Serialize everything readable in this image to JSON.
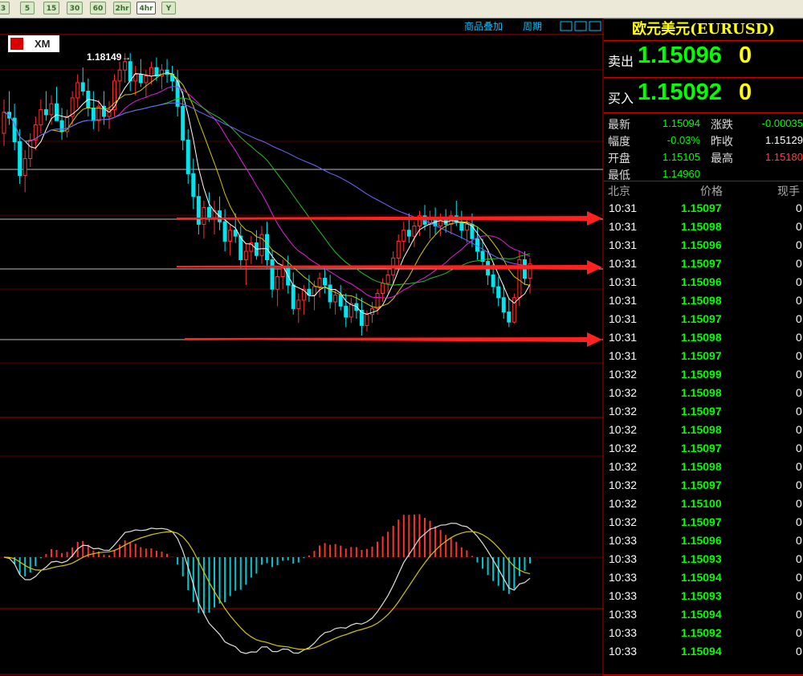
{
  "toolbar": {
    "timeframes": [
      {
        "label": "3",
        "active": false
      },
      {
        "label": "5",
        "active": false
      },
      {
        "label": "15",
        "active": false
      },
      {
        "label": "30",
        "active": false
      },
      {
        "label": "60",
        "active": false
      },
      {
        "label": "2hr",
        "active": false
      },
      {
        "label": "4hr",
        "active": true
      },
      {
        "label": "Y",
        "active": false
      }
    ]
  },
  "chart": {
    "logo": "XM",
    "menu_overlay": "商品叠加",
    "menu_period": "周期",
    "high_marker": "1.18149→",
    "candles": [
      [
        1.172,
        1.176,
        1.1705,
        1.1745
      ],
      [
        1.1745,
        1.177,
        1.173,
        1.1738
      ],
      [
        1.1738,
        1.1755,
        1.17,
        1.171
      ],
      [
        1.171,
        1.1725,
        1.166,
        1.167
      ],
      [
        1.167,
        1.17,
        1.165,
        1.169
      ],
      [
        1.169,
        1.172,
        1.168,
        1.1712
      ],
      [
        1.1712,
        1.174,
        1.17,
        1.173
      ],
      [
        1.173,
        1.176,
        1.172,
        1.1748
      ],
      [
        1.1748,
        1.177,
        1.1735,
        1.1742
      ],
      [
        1.1742,
        1.1765,
        1.173,
        1.1755
      ],
      [
        1.1755,
        1.1775,
        1.174,
        1.1735
      ],
      [
        1.1735,
        1.175,
        1.1712,
        1.1722
      ],
      [
        1.1722,
        1.1748,
        1.1715,
        1.174
      ],
      [
        1.174,
        1.177,
        1.173,
        1.1762
      ],
      [
        1.1762,
        1.179,
        1.175,
        1.178
      ],
      [
        1.178,
        1.1798,
        1.1765,
        1.177
      ],
      [
        1.177,
        1.1785,
        1.174,
        1.175
      ],
      [
        1.175,
        1.177,
        1.1725,
        1.1735
      ],
      [
        1.1735,
        1.176,
        1.1722,
        1.1752
      ],
      [
        1.1752,
        1.177,
        1.173,
        1.174
      ],
      [
        1.174,
        1.1758,
        1.1725,
        1.1748
      ],
      [
        1.1748,
        1.179,
        1.174,
        1.1782
      ],
      [
        1.1782,
        1.1805,
        1.1765,
        1.1795
      ],
      [
        1.1795,
        1.1815,
        1.178,
        1.1805
      ],
      [
        1.1805,
        1.1815,
        1.177,
        1.1782
      ],
      [
        1.1782,
        1.18,
        1.1765,
        1.179
      ],
      [
        1.179,
        1.1808,
        1.1775,
        1.178
      ],
      [
        1.178,
        1.1795,
        1.1762,
        1.1788
      ],
      [
        1.1788,
        1.1805,
        1.1778,
        1.1798
      ],
      [
        1.1798,
        1.181,
        1.1782,
        1.1788
      ],
      [
        1.1788,
        1.1802,
        1.1772,
        1.1795
      ],
      [
        1.1795,
        1.1808,
        1.178,
        1.179
      ],
      [
        1.179,
        1.18,
        1.177,
        1.1782
      ],
      [
        1.1782,
        1.1795,
        1.174,
        1.1752
      ],
      [
        1.1752,
        1.177,
        1.17,
        1.1712
      ],
      [
        1.1712,
        1.1725,
        1.166,
        1.1672
      ],
      [
        1.1672,
        1.169,
        1.163,
        1.1645
      ],
      [
        1.1645,
        1.166,
        1.16,
        1.1612
      ],
      [
        1.1612,
        1.164,
        1.1595,
        1.1632
      ],
      [
        1.1632,
        1.165,
        1.1615,
        1.162
      ],
      [
        1.162,
        1.164,
        1.16,
        1.1628
      ],
      [
        1.1628,
        1.1645,
        1.1605,
        1.1615
      ],
      [
        1.1615,
        1.163,
        1.158,
        1.1592
      ],
      [
        1.1592,
        1.1612,
        1.1575,
        1.1605
      ],
      [
        1.1605,
        1.1625,
        1.159,
        1.1598
      ],
      [
        1.1598,
        1.161,
        1.156,
        1.157
      ],
      [
        1.157,
        1.159,
        1.154,
        1.158
      ],
      [
        1.158,
        1.1598,
        1.1565,
        1.159
      ],
      [
        1.159,
        1.1605,
        1.157,
        1.1575
      ],
      [
        1.1575,
        1.161,
        1.1565,
        1.16
      ],
      [
        1.16,
        1.1615,
        1.156,
        1.157
      ],
      [
        1.157,
        1.1582,
        1.1525,
        1.1535
      ],
      [
        1.1535,
        1.156,
        1.1515,
        1.155
      ],
      [
        1.155,
        1.157,
        1.1535,
        1.156
      ],
      [
        1.156,
        1.1575,
        1.153,
        1.154
      ],
      [
        1.154,
        1.1555,
        1.1505,
        1.1512
      ],
      [
        1.1512,
        1.153,
        1.1495,
        1.1522
      ],
      [
        1.1522,
        1.154,
        1.1505,
        1.1535
      ],
      [
        1.1535,
        1.1552,
        1.152,
        1.1528
      ],
      [
        1.1528,
        1.1545,
        1.151,
        1.1538
      ],
      [
        1.1538,
        1.1555,
        1.1525,
        1.1548
      ],
      [
        1.1548,
        1.156,
        1.153,
        1.154
      ],
      [
        1.154,
        1.1552,
        1.1512,
        1.152
      ],
      [
        1.152,
        1.1535,
        1.1505,
        1.1528
      ],
      [
        1.1528,
        1.154,
        1.151,
        1.1515
      ],
      [
        1.1515,
        1.153,
        1.149,
        1.1502
      ],
      [
        1.1502,
        1.1525,
        1.1495,
        1.1518
      ],
      [
        1.1518,
        1.153,
        1.15,
        1.151
      ],
      [
        1.151,
        1.1525,
        1.148,
        1.1492
      ],
      [
        1.1492,
        1.151,
        1.1485,
        1.1505
      ],
      [
        1.1505,
        1.152,
        1.1495,
        1.1512
      ],
      [
        1.1512,
        1.1535,
        1.1505,
        1.153
      ],
      [
        1.153,
        1.1548,
        1.152,
        1.1542
      ],
      [
        1.1542,
        1.156,
        1.153,
        1.1552
      ],
      [
        1.1552,
        1.158,
        1.154,
        1.1572
      ],
      [
        1.1572,
        1.16,
        1.156,
        1.1592
      ],
      [
        1.1592,
        1.1615,
        1.158,
        1.1605
      ],
      [
        1.1605,
        1.1625,
        1.159,
        1.1598
      ],
      [
        1.1598,
        1.1615,
        1.1585,
        1.161
      ],
      [
        1.161,
        1.1628,
        1.1598,
        1.1622
      ],
      [
        1.1622,
        1.1635,
        1.1605,
        1.1612
      ],
      [
        1.1612,
        1.1628,
        1.1595,
        1.162
      ],
      [
        1.162,
        1.1632,
        1.16,
        1.161
      ],
      [
        1.161,
        1.1625,
        1.1598,
        1.1618
      ],
      [
        1.1618,
        1.163,
        1.1602,
        1.1612
      ],
      [
        1.1612,
        1.1628,
        1.16,
        1.1622
      ],
      [
        1.1622,
        1.164,
        1.161,
        1.1615
      ],
      [
        1.1615,
        1.1628,
        1.1595,
        1.1605
      ],
      [
        1.1605,
        1.162,
        1.159,
        1.1612
      ],
      [
        1.1612,
        1.1625,
        1.1585,
        1.1595
      ],
      [
        1.1595,
        1.1608,
        1.157,
        1.158
      ],
      [
        1.158,
        1.1595,
        1.156,
        1.1568
      ],
      [
        1.1568,
        1.158,
        1.154,
        1.1552
      ],
      [
        1.1552,
        1.1565,
        1.153,
        1.1538
      ],
      [
        1.1538,
        1.155,
        1.1515,
        1.1525
      ],
      [
        1.1525,
        1.154,
        1.15,
        1.1508
      ],
      [
        1.1508,
        1.1525,
        1.149,
        1.1496
      ],
      [
        1.1496,
        1.153,
        1.1494,
        1.1525
      ],
      [
        1.1525,
        1.158,
        1.1515,
        1.157
      ],
      [
        1.157,
        1.158,
        1.154,
        1.1548
      ],
      [
        1.1548,
        1.1572,
        1.153,
        1.1565
      ]
    ]
  },
  "panel": {
    "symbol": "欧元美元(EURUSD)",
    "sell_label": "卖出",
    "sell_value": "1.15096",
    "sell_digit": "0",
    "buy_label": "买入",
    "buy_value": "1.15092",
    "buy_digit": "0",
    "stats": [
      {
        "label": "最新",
        "value": "1.15094",
        "color": "#00ff00"
      },
      {
        "label": "涨跌",
        "value": "-0.00035",
        "color": "#00ff00"
      },
      {
        "label": "幅度",
        "value": "-0.03%",
        "color": "#00ff00"
      },
      {
        "label": "昨收",
        "value": "1.15129",
        "color": "#ffffff"
      },
      {
        "label": "开盘",
        "value": "1.15105",
        "color": "#00ff00"
      },
      {
        "label": "最高",
        "value": "1.15180",
        "color": "#ff4040"
      },
      {
        "label": "最低",
        "value": "1.14960",
        "color": "#00ff00"
      }
    ],
    "headers": {
      "time": "北京",
      "price": "价格",
      "volume": "现手"
    },
    "ticks": [
      {
        "time": "10:31",
        "price": "1.15097",
        "vol": "0"
      },
      {
        "time": "10:31",
        "price": "1.15098",
        "vol": "0"
      },
      {
        "time": "10:31",
        "price": "1.15096",
        "vol": "0"
      },
      {
        "time": "10:31",
        "price": "1.15097",
        "vol": "0"
      },
      {
        "time": "10:31",
        "price": "1.15096",
        "vol": "0"
      },
      {
        "time": "10:31",
        "price": "1.15098",
        "vol": "0"
      },
      {
        "time": "10:31",
        "price": "1.15097",
        "vol": "0"
      },
      {
        "time": "10:31",
        "price": "1.15098",
        "vol": "0"
      },
      {
        "time": "10:31",
        "price": "1.15097",
        "vol": "0"
      },
      {
        "time": "10:32",
        "price": "1.15099",
        "vol": "0"
      },
      {
        "time": "10:32",
        "price": "1.15098",
        "vol": "0"
      },
      {
        "time": "10:32",
        "price": "1.15097",
        "vol": "0"
      },
      {
        "time": "10:32",
        "price": "1.15098",
        "vol": "0"
      },
      {
        "time": "10:32",
        "price": "1.15097",
        "vol": "0"
      },
      {
        "time": "10:32",
        "price": "1.15098",
        "vol": "0"
      },
      {
        "time": "10:32",
        "price": "1.15097",
        "vol": "0"
      },
      {
        "time": "10:32",
        "price": "1.15100",
        "vol": "0"
      },
      {
        "time": "10:32",
        "price": "1.15097",
        "vol": "0"
      },
      {
        "time": "10:33",
        "price": "1.15096",
        "vol": "0"
      },
      {
        "time": "10:33",
        "price": "1.15093",
        "vol": "0"
      },
      {
        "time": "10:33",
        "price": "1.15094",
        "vol": "0"
      },
      {
        "time": "10:33",
        "price": "1.15093",
        "vol": "0"
      },
      {
        "time": "10:33",
        "price": "1.15094",
        "vol": "0"
      },
      {
        "time": "10:33",
        "price": "1.15092",
        "vol": "0"
      },
      {
        "time": "10:33",
        "price": "1.15094",
        "vol": "0"
      }
    ]
  }
}
